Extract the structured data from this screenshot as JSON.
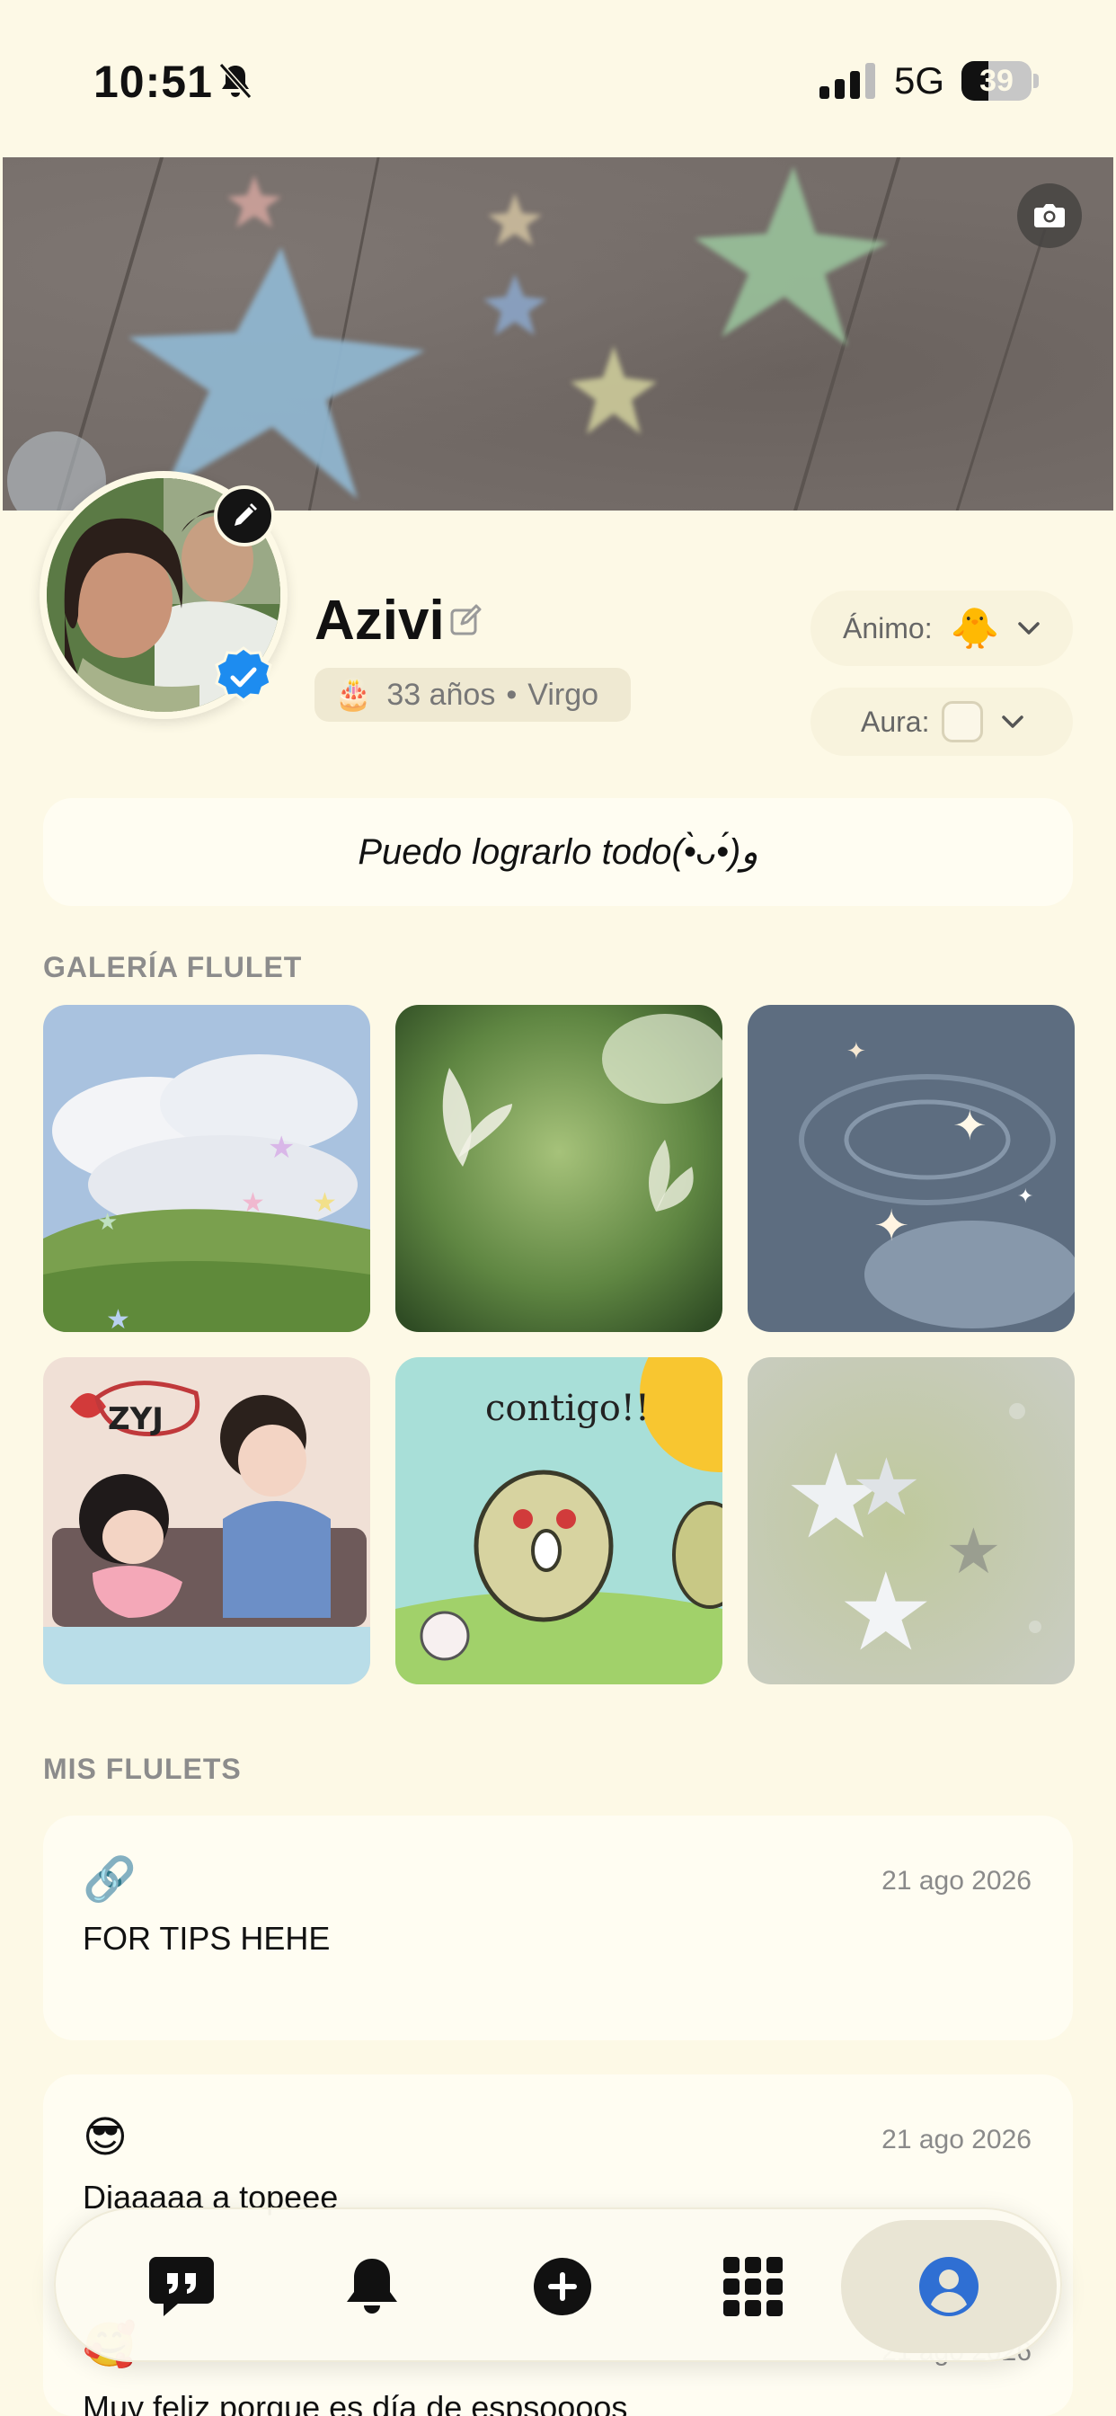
{
  "status_bar": {
    "time": "10:51",
    "network": "5G",
    "battery_level": "39",
    "battery_fraction": 0.39
  },
  "profile": {
    "name": "Azivi",
    "age": "33 años",
    "sign": "Virgo",
    "separator": "•",
    "cake_emoji": "🎂",
    "mood_label": "Ánimo:",
    "mood_emoji": "🐥",
    "aura_label": "Aura:",
    "bio": "Puedo lograrlo todo(•̀ᴗ•́)و"
  },
  "gallery": {
    "title": "GALERÍA FLULET",
    "items": [
      {
        "name": "clouds-stars",
        "colors": [
          "#b7cde6",
          "#6f9a4a"
        ]
      },
      {
        "name": "butterflies-green",
        "colors": [
          "#7fa35b",
          "#3d5e2c"
        ]
      },
      {
        "name": "water-sparkles",
        "colors": [
          "#56667a",
          "#8fa1b3"
        ]
      },
      {
        "name": "couple-drawing",
        "colors": [
          "#f0e1d6",
          "#6e8cc4"
        ]
      },
      {
        "name": "contigo-drawing",
        "colors": [
          "#a9dcd5",
          "#9ecf63"
        ],
        "caption": "contigo!!"
      },
      {
        "name": "stars-on-green",
        "colors": [
          "#c9cfb3",
          "#a9b68a"
        ]
      }
    ]
  },
  "flulets": {
    "title": "MIS FLULETS",
    "items": [
      {
        "emoji": "🔗",
        "date": "21 ago 2026",
        "text": "FOR TIPS HEHE"
      },
      {
        "emoji": "😎",
        "date": "21 ago 2026",
        "text": "Diaaaaa a topeee"
      },
      {
        "emoji": "🥰",
        "date": "21 ago 2026",
        "text": "Muy feliz porque es día de espsoooos"
      }
    ]
  },
  "nav": {
    "items": [
      "quote-icon",
      "bell-icon",
      "plus-icon",
      "grid-icon",
      "profile-icon"
    ],
    "active": "profile-icon",
    "accent": "#2f6fd3"
  }
}
